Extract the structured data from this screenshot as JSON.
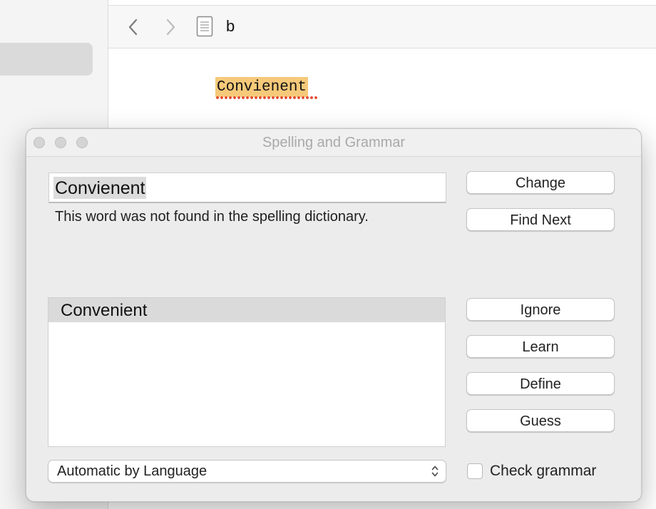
{
  "background_window": {
    "document_title": "b",
    "misspelled_word": "Convienent",
    "icons": {
      "back": "chevron-left-icon",
      "forward": "chevron-right-icon",
      "document": "document-icon"
    }
  },
  "panel": {
    "title": "Spelling and Grammar",
    "word": "Convienent",
    "message": "This word was not found in the spelling dictionary.",
    "buttons": {
      "change": "Change",
      "find_next": "Find Next",
      "ignore": "Ignore",
      "learn": "Learn",
      "define": "Define",
      "guess": "Guess"
    },
    "suggestions": [
      "Convenient"
    ],
    "selected_suggestion": "Convenient",
    "language": "Automatic by Language",
    "check_grammar_label": "Check grammar",
    "check_grammar_checked": false
  },
  "colors": {
    "highlight": "#f6c97a",
    "misspelling_underline": "#e2492f",
    "selection": "#dadada"
  }
}
